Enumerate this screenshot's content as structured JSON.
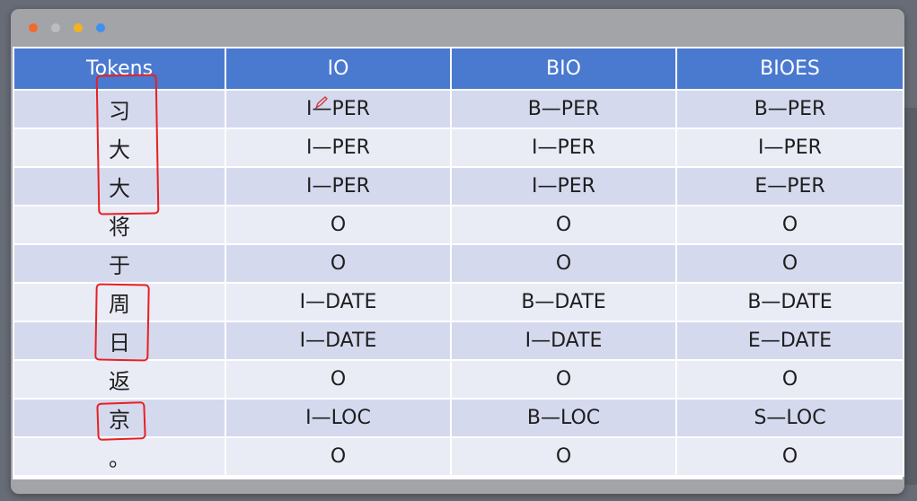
{
  "window": {
    "dots": [
      {
        "name": "close",
        "color": "#f2692a"
      },
      {
        "name": "minimize",
        "color": "#bdbdbd"
      },
      {
        "name": "maximize",
        "color": "#f5b21c"
      },
      {
        "name": "extra",
        "color": "#3f8ff0"
      }
    ]
  },
  "table": {
    "headers": [
      "Tokens",
      "IO",
      "BIO",
      "BIOES"
    ],
    "rows": [
      [
        "习",
        "I—PER",
        "B—PER",
        "B—PER"
      ],
      [
        "大",
        "I—PER",
        "I—PER",
        "I—PER"
      ],
      [
        "大",
        "I—PER",
        "I—PER",
        "E—PER"
      ],
      [
        "将",
        "O",
        "O",
        "O"
      ],
      [
        "于",
        "O",
        "O",
        "O"
      ],
      [
        "周",
        "I—DATE",
        "B—DATE",
        "B—DATE"
      ],
      [
        "日",
        "I—DATE",
        "I—DATE",
        "E—DATE"
      ],
      [
        "返",
        "O",
        "O",
        "O"
      ],
      [
        "京",
        "I—LOC",
        "B—LOC",
        "S—LOC"
      ],
      [
        "。",
        "O",
        "O",
        "O"
      ]
    ]
  },
  "colors": {
    "header_bg": "#4a79d0",
    "row_odd": "#d4d9ee",
    "row_even": "#e9ebf5",
    "annotation": "#e82020"
  },
  "annotation_icon": "pen-icon"
}
